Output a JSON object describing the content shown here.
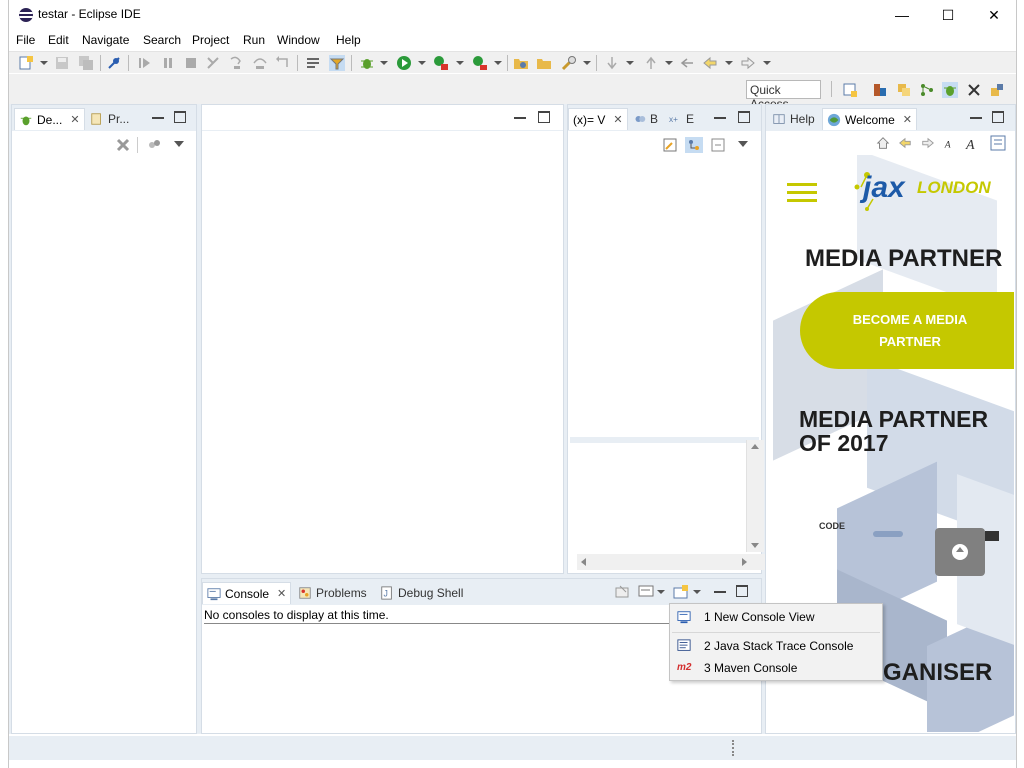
{
  "window": {
    "title": "testar - Eclipse IDE",
    "controls": {
      "minimize": "—",
      "maximize": "☐",
      "close": "✕"
    }
  },
  "menubar": {
    "items": [
      "File",
      "Edit",
      "Navigate",
      "Search",
      "Project",
      "Run",
      "Window",
      "Help"
    ]
  },
  "quick_access": {
    "placeholder": "Quick Access"
  },
  "left_panel": {
    "tabs": [
      {
        "label": "De...",
        "active": true,
        "icon": "debug-icon"
      },
      {
        "label": "Pr...",
        "active": false,
        "icon": "project-explorer-icon"
      }
    ]
  },
  "variables_panel": {
    "tabs": [
      {
        "label": "(x)= V",
        "active": true,
        "icon": "variables-icon"
      },
      {
        "label": "B",
        "active": false,
        "icon": "breakpoints-icon"
      },
      {
        "label": "E",
        "active": false,
        "icon": "expressions-icon"
      }
    ]
  },
  "welcome_panel": {
    "tabs": [
      {
        "label": "Help",
        "active": false,
        "icon": "help-icon"
      },
      {
        "label": "Welcome",
        "active": true,
        "icon": "welcome-icon"
      }
    ],
    "content": {
      "logo_text": "jax",
      "logo_suffix": "LONDON",
      "heading1": "MEDIA PARTNER",
      "cta_line1": "BECOME A MEDIA",
      "cta_line2": "PARTNER",
      "heading2_line1": "MEDIA PARTNER",
      "heading2_line2": "OF 2017",
      "partner_logo1": "CODE",
      "heading3": "GANISER",
      "accent_color": "#c5c800"
    }
  },
  "console_panel": {
    "tabs": [
      {
        "label": "Console",
        "active": true,
        "icon": "console-icon"
      },
      {
        "label": "Problems",
        "active": false,
        "icon": "problems-icon"
      },
      {
        "label": "Debug Shell",
        "active": false,
        "icon": "debug-shell-icon"
      }
    ],
    "message": "No consoles to display at this time."
  },
  "context_menu": {
    "items": [
      {
        "label": "1 New Console View",
        "icon": "new-console-icon"
      },
      {
        "label": "2 Java Stack Trace Console",
        "icon": "stack-trace-icon"
      },
      {
        "label": "3 Maven Console",
        "icon": "maven-icon",
        "badge": "m2"
      }
    ]
  },
  "colors": {
    "workbench_bg": "#e8eef4",
    "panel_border": "#d5dde6",
    "accent": "#c5c800"
  }
}
